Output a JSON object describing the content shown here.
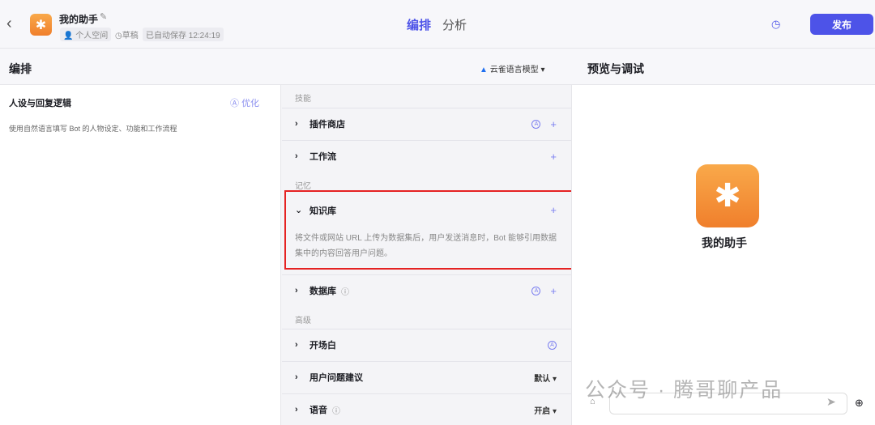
{
  "header": {
    "bot_name": "我的助手",
    "workspace": "个人空间",
    "status": "草稿",
    "autosave": "已自动保存 12:24:19",
    "tabs": [
      "编排",
      "分析"
    ],
    "publish": "发布"
  },
  "compose": {
    "title": "编排",
    "model": "云雀语言模型"
  },
  "persona": {
    "title": "人设与回复逻辑",
    "optimize": "优化",
    "placeholder": "使用自然语言填写 Bot 的人物设定、功能和工作流程"
  },
  "skills": {
    "group_skills": "技能",
    "plugin_store": "插件商店",
    "workflow": "工作流",
    "group_memory": "记忆",
    "knowledge": "知识库",
    "knowledge_desc": "将文件或网站 URL 上传为数据集后，用户发送消息时，Bot 能够引用数据集中的内容回答用户问题。",
    "database": "数据库",
    "group_advanced": "高级",
    "opening": "开场白",
    "suggestions": "用户问题建议",
    "suggestions_value": "默认",
    "voice": "语音",
    "voice_value": "开启"
  },
  "preview": {
    "title": "预览与调试",
    "bot_name": "我的助手"
  },
  "watermark": "公众号 · 腾哥聊产品",
  "colors": {
    "accent": "#4d53e8",
    "highlight": "#e52222"
  }
}
